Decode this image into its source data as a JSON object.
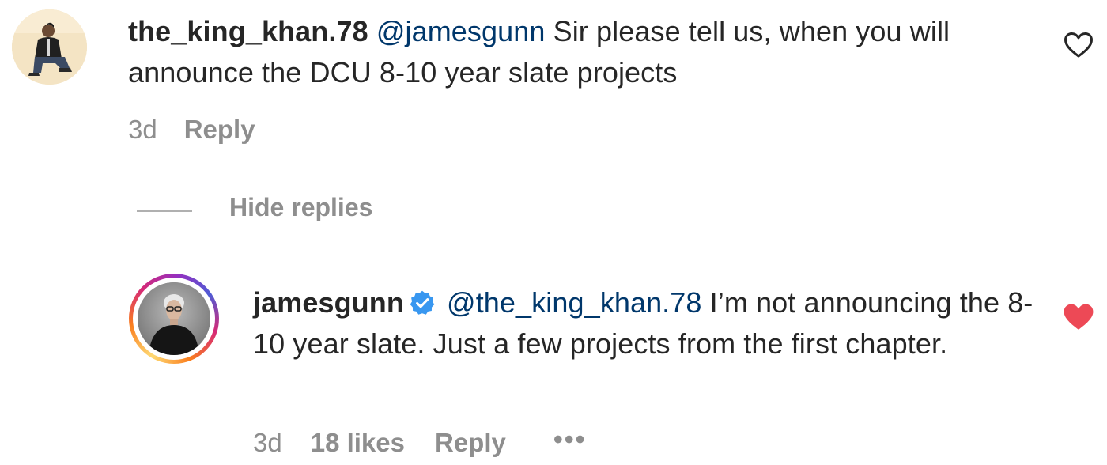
{
  "comments": [
    {
      "username": "the_king_khan.78",
      "mention": "@jamesgunn",
      "text": " Sir please tell us, when you will announce the DCU 8-10 year slate projects",
      "time": "3d",
      "reply_label": "Reply",
      "liked": false
    }
  ],
  "hide_replies_label": "Hide replies",
  "reply": {
    "username": "jamesgunn",
    "verified": true,
    "mention": "@the_king_khan.78",
    "text": " I’m not announcing the 8-10 year slate. Just a few projects from the first chapter.",
    "time": "3d",
    "likes": "18 likes",
    "reply_label": "Reply",
    "more_label": "•••",
    "liked": true
  },
  "colors": {
    "text": "#262626",
    "mention": "#00376b",
    "muted": "#8e8e8e",
    "like_red": "#ed4956",
    "verified_blue": "#3897f0"
  },
  "icons": {
    "like_outline": "heart-outline-icon",
    "like_filled": "heart-filled-icon",
    "verified": "verified-badge-icon"
  }
}
